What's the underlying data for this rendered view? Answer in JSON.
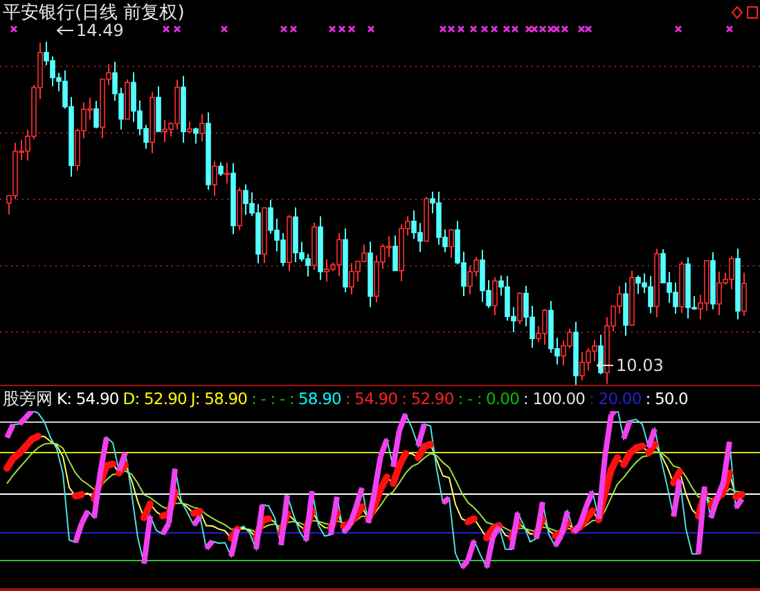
{
  "title": "平安银行(日线 前复权)",
  "price_labels": [
    {
      "kind": "high",
      "text": "14.49"
    },
    {
      "kind": "low",
      "text": "10.03"
    }
  ],
  "indicator": {
    "name": "股旁网",
    "values": [
      {
        "text": "K: 54.90",
        "color": "#ffffff"
      },
      {
        "text": "D: 52.90",
        "color": "#ffff00"
      },
      {
        "text": "J: 58.90",
        "color": "#ffff00"
      },
      {
        "text": ": - : - :",
        "color": "#00c000"
      },
      {
        "text": "58.90",
        "color": "#00ffff"
      },
      {
        "text": ": 54.90",
        "color": "#ff2020"
      },
      {
        "text": ": 52.90",
        "color": "#ff2020"
      },
      {
        "text": ": - :",
        "color": "#00c000"
      },
      {
        "text": "0.00",
        "color": "#00c000"
      },
      {
        "text": ": 100.00",
        "color": "#e0e0e0"
      },
      {
        "text": ": 20.00",
        "color": "#2020d0"
      },
      {
        "text": ": 50.0",
        "color": "#ffffff"
      }
    ]
  }
}
